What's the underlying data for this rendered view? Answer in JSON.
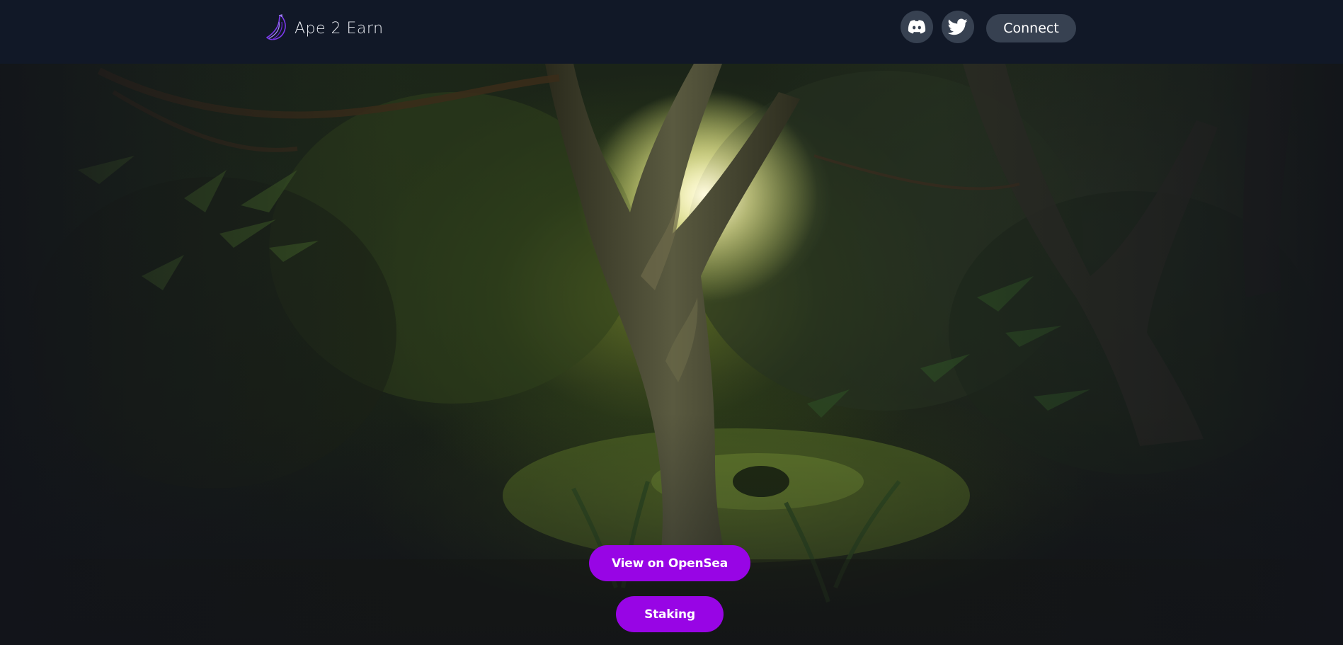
{
  "header": {
    "brand_name": "Ape 2 Earn",
    "brand_icon": "banana-icon",
    "social": [
      {
        "name": "discord",
        "icon": "discord-icon"
      },
      {
        "name": "twitter",
        "icon": "twitter-icon"
      }
    ],
    "connect_label": "Connect"
  },
  "hero": {
    "background": "jungle-forest-image",
    "buttons": {
      "opensea_label": "View on OpenSea",
      "staking_label": "Staking"
    }
  },
  "colors": {
    "navbar_bg": "#111827",
    "pill_bg": "#374151",
    "accent_purple": "#9805e5",
    "logo_stroke": "#7c3aed"
  }
}
